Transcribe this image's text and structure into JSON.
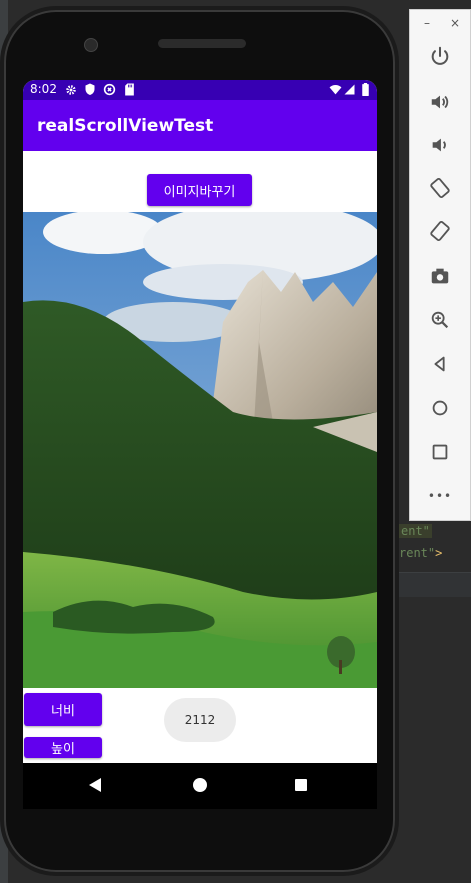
{
  "ide": {
    "code_line_1": "ent\"",
    "code_line_2_text": "rent\"",
    "code_line_2_bracket": ">"
  },
  "side_panel": {
    "minimize_label": "–",
    "close_label": "×",
    "buttons": [
      {
        "icon": "power-icon"
      },
      {
        "icon": "volume-up-icon"
      },
      {
        "icon": "volume-down-icon"
      },
      {
        "icon": "rotate-left-icon"
      },
      {
        "icon": "rotate-right-icon"
      },
      {
        "icon": "camera-icon"
      },
      {
        "icon": "zoom-icon"
      },
      {
        "icon": "back-icon"
      },
      {
        "icon": "home-icon"
      },
      {
        "icon": "overview-icon"
      },
      {
        "icon": "more-icon"
      }
    ],
    "more_label": "•••"
  },
  "phone": {
    "status_bar": {
      "time": "8:02",
      "icons": [
        "gear-icon",
        "shield-icon",
        "sync-icon",
        "sd-card-icon",
        "wifi-icon",
        "signal-icon",
        "battery-icon"
      ]
    },
    "app_title": "realScrollViewTest",
    "change_image_button": "이미지바꾸기",
    "width_button": "너비",
    "height_button": "높이",
    "value_display": "2112",
    "colors": {
      "status_bar": "#3700b3",
      "app_bar": "#6200ee",
      "button": "#6200ee"
    }
  }
}
